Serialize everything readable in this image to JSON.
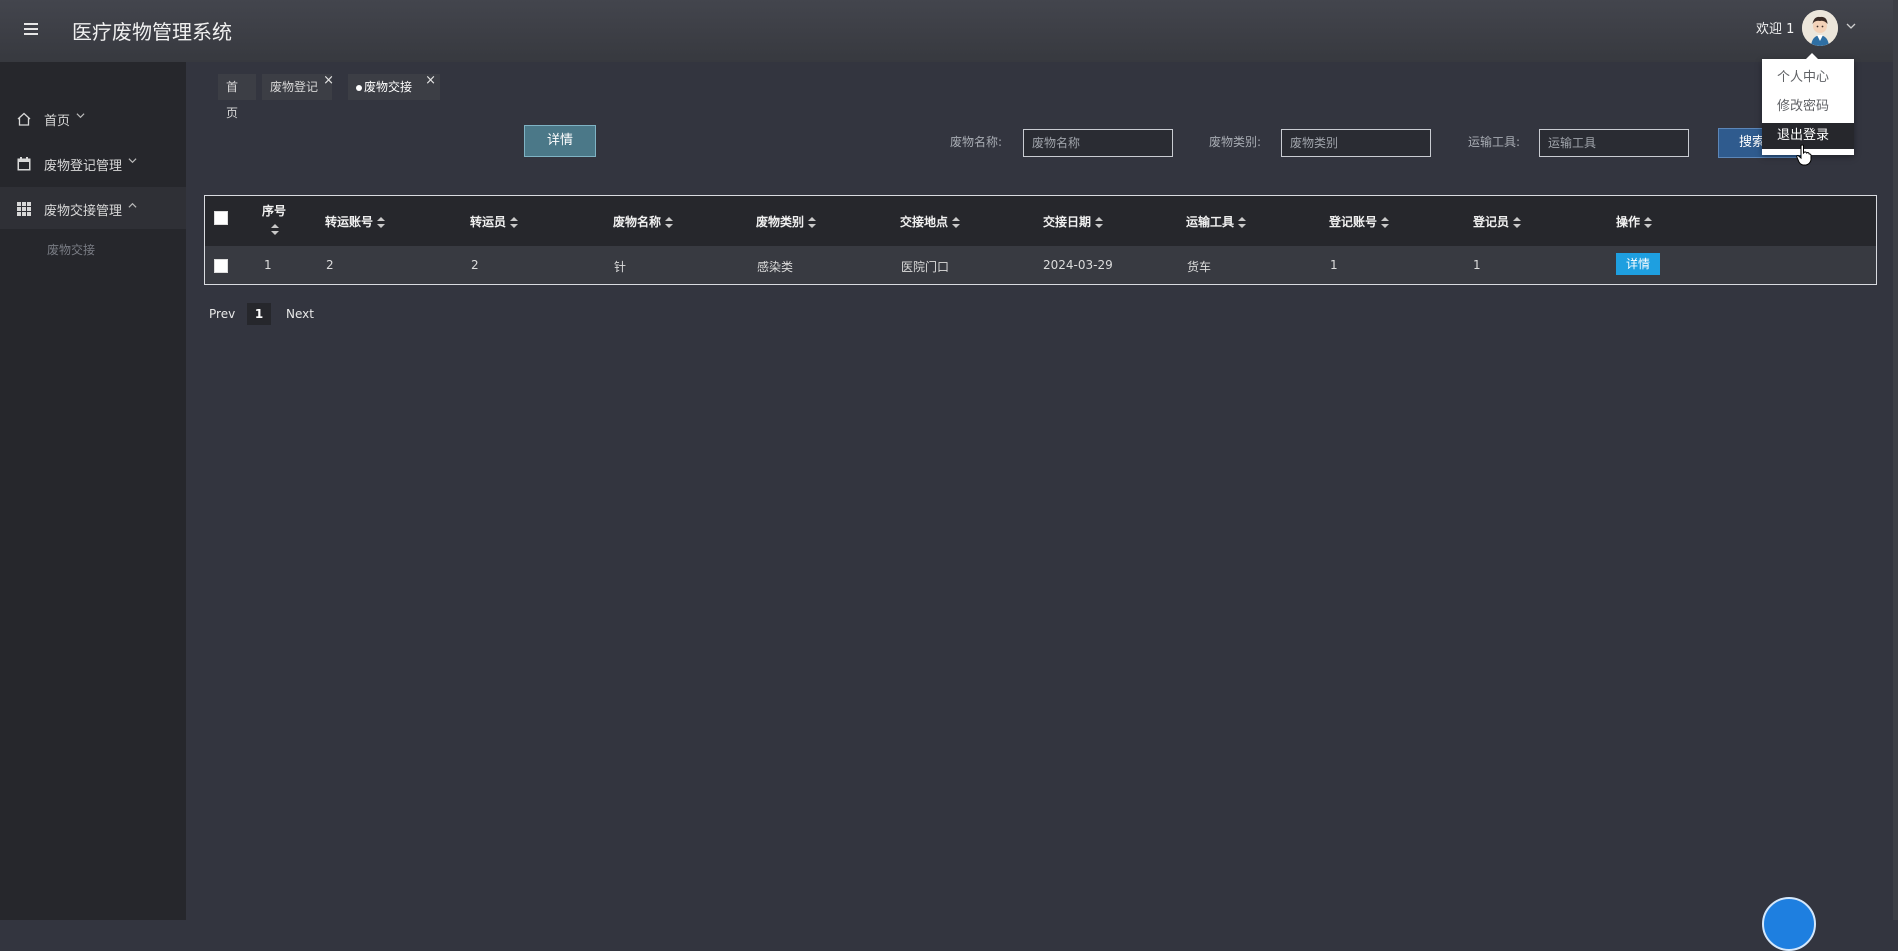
{
  "app": {
    "title": "医疗废物管理系统"
  },
  "header": {
    "welcome": "欢迎 1",
    "menu_icon": "hamburger-icon",
    "avatar_icon": "user-avatar"
  },
  "user_menu": {
    "items": [
      {
        "label": "个人中心"
      },
      {
        "label": "修改密码"
      },
      {
        "label": "退出登录"
      }
    ]
  },
  "sidebar": {
    "items": [
      {
        "label": "首页",
        "icon": "home-icon"
      },
      {
        "label": "废物登记管理",
        "icon": "calendar-icon"
      },
      {
        "label": "废物交接管理",
        "icon": "grid-icon"
      }
    ],
    "sub_items": [
      {
        "label": "废物交接"
      }
    ]
  },
  "tabs": [
    {
      "label": "首页"
    },
    {
      "label": "废物登记"
    },
    {
      "label": "废物交接"
    }
  ],
  "toolbar": {
    "detail_label": "详情",
    "search_label": "搜索",
    "filters": [
      {
        "label": "废物名称:",
        "placeholder": "废物名称"
      },
      {
        "label": "废物类别:",
        "placeholder": "废物类别"
      },
      {
        "label": "运输工具:",
        "placeholder": "运输工具"
      }
    ]
  },
  "table": {
    "columns": [
      "序号",
      "转运账号",
      "转运员",
      "废物名称",
      "废物类别",
      "交接地点",
      "交接日期",
      "运输工具",
      "登记账号",
      "登记员",
      "操作"
    ],
    "rows": [
      {
        "cells": [
          "1",
          "2",
          "2",
          "针",
          "感染类",
          "医院门口",
          "2024-03-29",
          "货车",
          "1",
          "1"
        ],
        "action": "详情"
      }
    ]
  },
  "pagination": {
    "prev": "Prev",
    "current": "1",
    "next": "Next"
  },
  "colors": {
    "accent": "#1e9fe0",
    "header_bg": "#3c3e45",
    "sidebar_bg": "#26272c",
    "content_bg": "#33353f"
  }
}
